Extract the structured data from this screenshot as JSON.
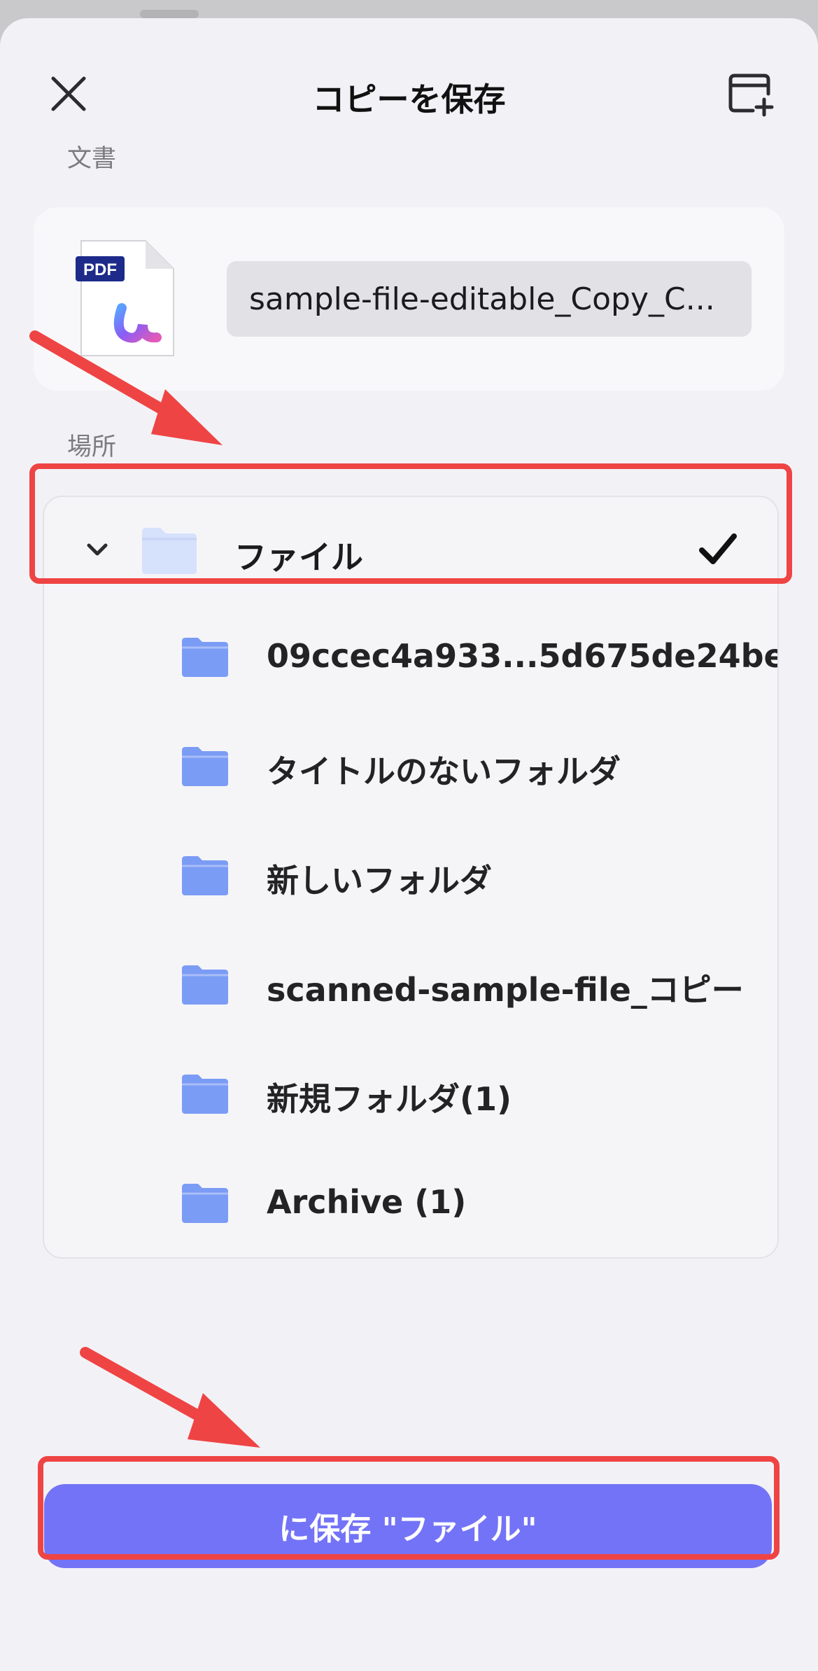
{
  "header": {
    "title": "コピーを保存"
  },
  "document_section": {
    "label": "文書",
    "thumbnail_badge": "PDF",
    "file_name": "sample-file-editable_Copy_C..."
  },
  "location_section": {
    "label": "場所",
    "root": {
      "label": "ファイル",
      "selected": true
    },
    "folders": [
      {
        "label": "09ccec4a933...5d675de24be"
      },
      {
        "label": "タイトルのないフォルダ"
      },
      {
        "label": "新しいフォルダ"
      },
      {
        "label": "scanned-sample-file_コピー"
      },
      {
        "label": "新規フォルダ(1)"
      },
      {
        "label": "Archive (1)"
      }
    ]
  },
  "save_button": {
    "label": "に保存 \"ファイル\""
  },
  "colors": {
    "accent": "#7373f7",
    "highlight": "#ef4444",
    "folder": "#7b9cf5",
    "folder_selected": "#d6e1fb"
  },
  "icons": [
    "close-icon",
    "new-folder-icon",
    "pdf-file-icon",
    "chevron-down-icon",
    "folder-icon",
    "checkmark-icon"
  ]
}
